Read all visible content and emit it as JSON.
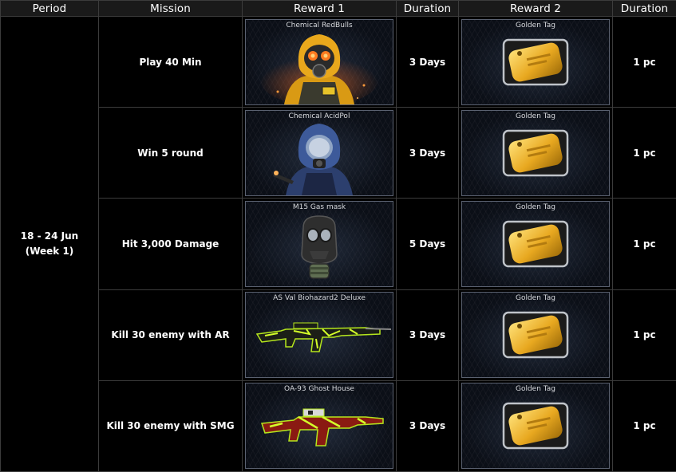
{
  "headers": {
    "period": "Period",
    "mission": "Mission",
    "reward1": "Reward 1",
    "duration1": "Duration",
    "reward2": "Reward 2",
    "duration2": "Duration"
  },
  "period": {
    "line1": "18 - 24 Jun",
    "line2": "(Week 1)"
  },
  "rows": [
    {
      "mission": "Play 40 Min",
      "reward1": {
        "name": "Chemical RedBulls",
        "icon": "hazmat-red-soldier-icon"
      },
      "duration1": "3 Days",
      "reward2": {
        "name": "Golden Tag",
        "icon": "golden-tag-icon"
      },
      "duration2": "1 pc"
    },
    {
      "mission": "Win 5 round",
      "reward1": {
        "name": "Chemical AcidPol",
        "icon": "hazmat-blue-soldier-icon"
      },
      "duration1": "3 Days",
      "reward2": {
        "name": "Golden Tag",
        "icon": "golden-tag-icon"
      },
      "duration2": "1 pc"
    },
    {
      "mission": "Hit 3,000 Damage",
      "reward1": {
        "name": "M15 Gas mask",
        "icon": "gas-mask-icon"
      },
      "duration1": "5 Days",
      "reward2": {
        "name": "Golden Tag",
        "icon": "golden-tag-icon"
      },
      "duration2": "1 pc"
    },
    {
      "mission": "Kill 30 enemy with AR",
      "reward1": {
        "name": "AS Val Biohazard2 Deluxe",
        "icon": "assault-rifle-icon"
      },
      "duration1": "3 Days",
      "reward2": {
        "name": "Golden Tag",
        "icon": "golden-tag-icon"
      },
      "duration2": "1 pc"
    },
    {
      "mission": "Kill 30 enemy with SMG",
      "reward1": {
        "name": "OA-93 Ghost House",
        "icon": "submachine-gun-icon"
      },
      "duration1": "3 Days",
      "reward2": {
        "name": "Golden Tag",
        "icon": "golden-tag-icon"
      },
      "duration2": "1 pc"
    }
  ],
  "colors": {
    "background": "#000000",
    "border": "#3c3c3c",
    "text": "#ffffff",
    "gold": "#e8a820",
    "toxic_green": "#b5e61d"
  }
}
